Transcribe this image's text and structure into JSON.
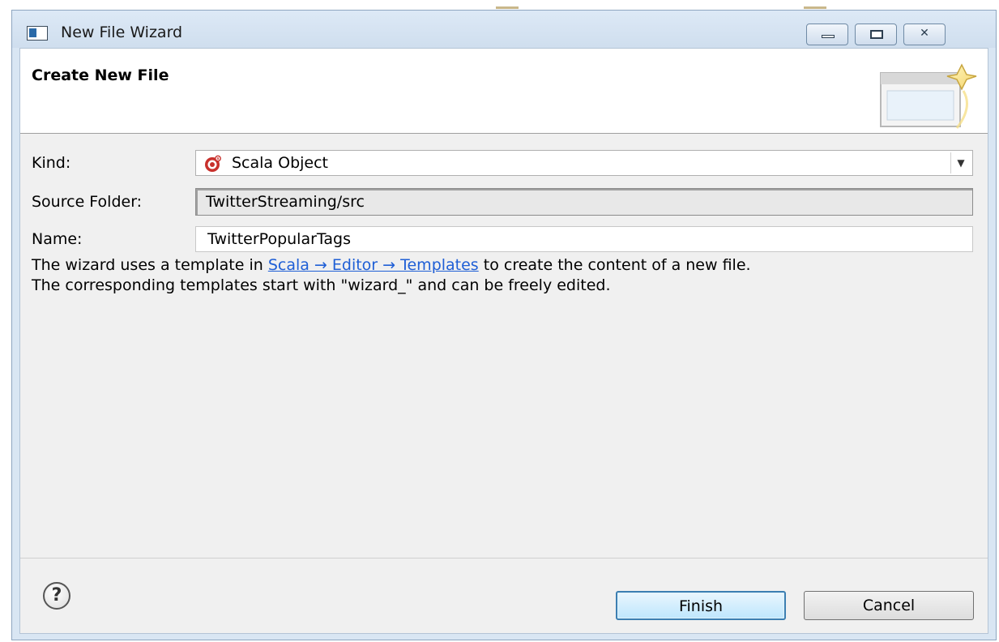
{
  "window": {
    "title": "New File Wizard"
  },
  "header": {
    "title": "Create New File"
  },
  "form": {
    "kind_label": "Kind:",
    "kind_value": "Scala Object",
    "source_folder_label": "Source Folder:",
    "source_folder_value": "TwitterStreaming/src",
    "name_label": "Name:",
    "name_value": "TwitterPopularTags"
  },
  "info": {
    "line1_before": "The wizard uses a template in ",
    "link_text": "Scala → Editor → Templates",
    "line1_after": " to create the content of a new file.",
    "line2": "The corresponding templates start with \"wizard_\" and can be freely edited."
  },
  "buttons": {
    "finish": "Finish",
    "cancel": "Cancel",
    "help": "?"
  },
  "icons": {
    "app": "window-icon",
    "kind": "scala-object-icon",
    "help": "help-icon",
    "banner": "new-file-wizard-banner"
  },
  "colors": {
    "link": "#1f5fd6",
    "finish_border": "#3c7fb1",
    "scala_red": "#c8302c"
  }
}
